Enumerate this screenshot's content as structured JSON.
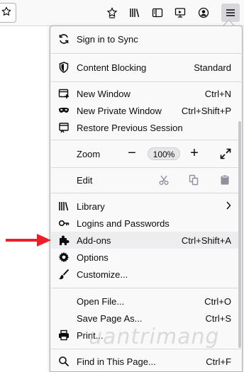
{
  "toolbar": {
    "buttons": [
      "star-icon",
      "library-icon",
      "sidebar-icon",
      "screenshot-icon",
      "account-icon",
      "menu-icon"
    ]
  },
  "menu": {
    "sync": {
      "label": "Sign in to Sync"
    },
    "content_blocking": {
      "label": "Content Blocking",
      "value": "Standard"
    },
    "new_window": {
      "label": "New Window",
      "shortcut": "Ctrl+N"
    },
    "new_private_window": {
      "label": "New Private Window",
      "shortcut": "Ctrl+Shift+P"
    },
    "restore_session": {
      "label": "Restore Previous Session"
    },
    "zoom": {
      "label": "Zoom",
      "minus": "−",
      "value": "100%",
      "plus": "+"
    },
    "edit": {
      "label": "Edit"
    },
    "library": {
      "label": "Library"
    },
    "logins": {
      "label": "Logins and Passwords"
    },
    "addons": {
      "label": "Add-ons",
      "shortcut": "Ctrl+Shift+A"
    },
    "options": {
      "label": "Options"
    },
    "customize": {
      "label": "Customize..."
    },
    "open_file": {
      "label": "Open File...",
      "shortcut": "Ctrl+O"
    },
    "save_page": {
      "label": "Save Page As...",
      "shortcut": "Ctrl+S"
    },
    "print": {
      "label": "Print..."
    },
    "find": {
      "label": "Find in This Page...",
      "shortcut": "Ctrl+F"
    }
  },
  "watermark": {
    "text": "uantrimang"
  },
  "colors": {
    "accent_arrow": "#e8202a",
    "hover": "#ededf0"
  }
}
